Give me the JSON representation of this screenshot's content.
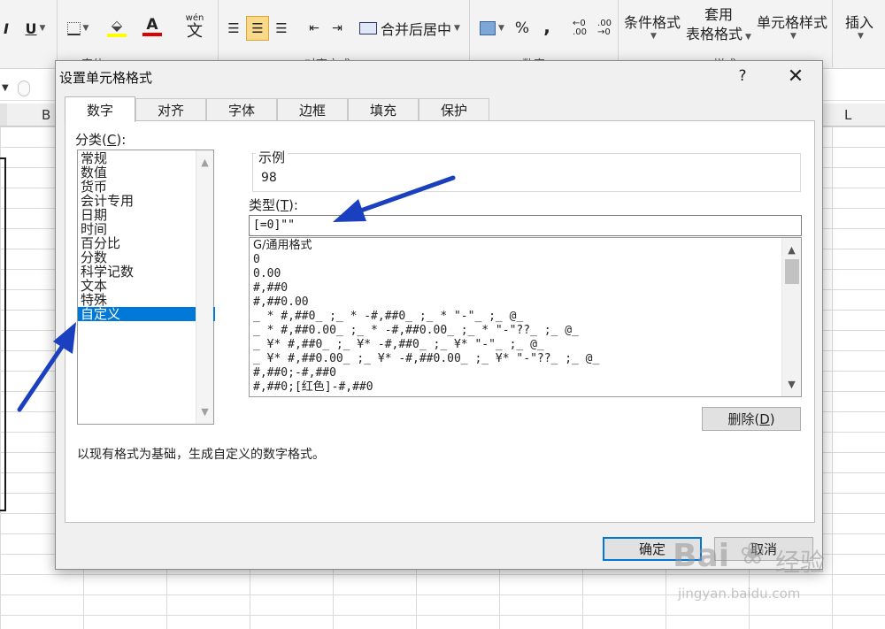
{
  "ribbon": {
    "underline_label": "U",
    "italic_label": "I",
    "font_color_label": "A",
    "wen_label": "wén",
    "wen_char": "文",
    "merge_center_label": "合并后居中",
    "percent_label": "%",
    "comma_label": ",",
    "cond_format_label": "条件格式",
    "table_format_line1": "套用",
    "table_format_line2": "表格格式",
    "cell_style_label": "单元格样式",
    "insert_label": "插入",
    "group_font": "字体",
    "group_align": "对齐方式",
    "group_number": "数字",
    "group_style": "样式"
  },
  "sheet": {
    "columns": [
      "B",
      "L"
    ]
  },
  "dialog": {
    "title": "设置单元格格式",
    "help": "?",
    "close": "✕",
    "tabs": [
      "数字",
      "对齐",
      "字体",
      "边框",
      "填充",
      "保护"
    ],
    "active_tab": "数字",
    "category_label_prefix": "分类(",
    "category_label_key": "C",
    "category_label_suffix": "):",
    "categories": [
      "常规",
      "数值",
      "货币",
      "会计专用",
      "日期",
      "时间",
      "百分比",
      "分数",
      "科学记数",
      "文本",
      "特殊",
      "自定义"
    ],
    "selected_category": "自定义",
    "sample_label": "示例",
    "sample_value": "98",
    "type_label_prefix": "类型(",
    "type_label_key": "T",
    "type_label_suffix": "):",
    "type_value": "[=0]\"\"",
    "format_codes": [
      "G/通用格式",
      "0",
      "0.00",
      "#,##0",
      "#,##0.00",
      "_ * #,##0_ ;_ * -#,##0_ ;_ * \"-\"_ ;_ @_",
      "_ * #,##0.00_ ;_ * -#,##0.00_ ;_ * \"-\"??_ ;_ @_",
      "_ ¥* #,##0_ ;_ ¥* -#,##0_ ;_ ¥* \"-\"_ ;_ @_",
      "_ ¥* #,##0.00_ ;_ ¥* -#,##0.00_ ;_ ¥* \"-\"??_ ;_ @_",
      "#,##0;-#,##0",
      "#,##0;[红色]-#,##0"
    ],
    "delete_label_prefix": "删除(",
    "delete_label_key": "D",
    "delete_label_suffix": ")",
    "description": "以现有格式为基础，生成自定义的数字格式。",
    "ok_label": "确定",
    "cancel_label": "取消"
  },
  "watermark": {
    "brand": "Bai",
    "brand_cn": "经验",
    "url": "jingyan.baidu.com"
  },
  "colors": {
    "selection": "#0078d7",
    "annotation_arrow": "#1a3fbf",
    "font_color_red": "#e00000",
    "highlight_yellow": "#ffff00"
  }
}
